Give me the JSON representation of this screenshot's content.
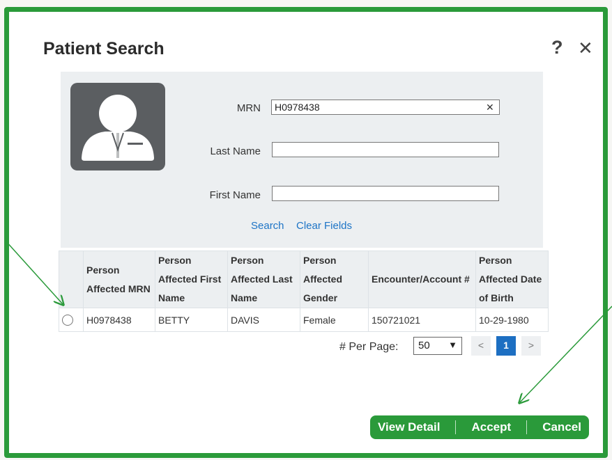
{
  "dialog": {
    "title": "Patient Search",
    "help_label": "?",
    "close_label": "✕"
  },
  "form": {
    "mrn_label": "MRN",
    "mrn_value": "H0978438",
    "mrn_clear": "✕",
    "last_name_label": "Last Name",
    "last_name_value": "",
    "first_name_label": "First Name",
    "first_name_value": "",
    "search_link": "Search",
    "clear_link": "Clear Fields"
  },
  "table": {
    "headers": [
      "Person Affected MRN",
      "Person Affected First Name",
      "Person Affected Last Name",
      "Person Affected Gender",
      "Encounter/Account #",
      "Person Affected Date of Birth"
    ],
    "rows": [
      [
        "H0978438",
        "BETTY",
        "DAVIS",
        "Female",
        "150721021",
        "10-29-1980"
      ]
    ]
  },
  "pager": {
    "per_page_label": "# Per Page:",
    "per_page_value": "50",
    "prev_label": "<",
    "current_page": "1",
    "next_label": ">"
  },
  "actions": {
    "view_detail": "View Detail",
    "accept": "Accept",
    "cancel": "Cancel"
  },
  "colors": {
    "frame": "#2a9a3a",
    "link": "#1d74c6",
    "current_page": "#1d6fc2",
    "panel": "#eceff1"
  }
}
